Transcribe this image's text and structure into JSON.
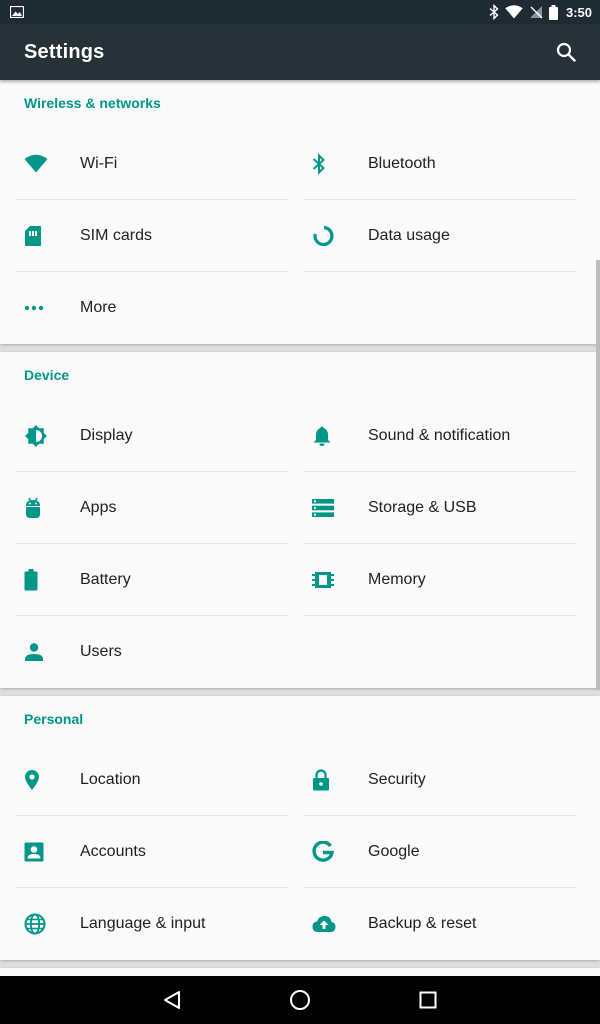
{
  "status_bar": {
    "time": "3:50"
  },
  "app_bar": {
    "title": "Settings",
    "search_icon": "search-icon"
  },
  "colors": {
    "accent": "#009688",
    "app_bar": "#263238",
    "status_bar": "#1f2b32"
  },
  "sections": [
    {
      "title": "Wireless & networks",
      "items": [
        {
          "label": "Wi-Fi",
          "icon": "wifi-icon"
        },
        {
          "label": "Bluetooth",
          "icon": "bluetooth-icon"
        },
        {
          "label": "SIM cards",
          "icon": "sim-card-icon"
        },
        {
          "label": "Data usage",
          "icon": "data-usage-icon"
        },
        {
          "label": "More",
          "icon": "more-dots-icon"
        }
      ]
    },
    {
      "title": "Device",
      "items": [
        {
          "label": "Display",
          "icon": "brightness-icon"
        },
        {
          "label": "Sound & notification",
          "icon": "bell-icon"
        },
        {
          "label": "Apps",
          "icon": "android-icon"
        },
        {
          "label": "Storage & USB",
          "icon": "storage-icon"
        },
        {
          "label": "Battery",
          "icon": "battery-icon"
        },
        {
          "label": "Memory",
          "icon": "memory-chip-icon"
        },
        {
          "label": "Users",
          "icon": "person-icon"
        }
      ]
    },
    {
      "title": "Personal",
      "items": [
        {
          "label": "Location",
          "icon": "location-pin-icon"
        },
        {
          "label": "Security",
          "icon": "lock-icon"
        },
        {
          "label": "Accounts",
          "icon": "account-box-icon"
        },
        {
          "label": "Google",
          "icon": "google-icon"
        },
        {
          "label": "Language & input",
          "icon": "globe-icon"
        },
        {
          "label": "Backup & reset",
          "icon": "cloud-upload-icon"
        }
      ]
    }
  ],
  "nav_bar": {
    "back": "back-icon",
    "home": "home-icon",
    "recents": "recents-icon"
  }
}
